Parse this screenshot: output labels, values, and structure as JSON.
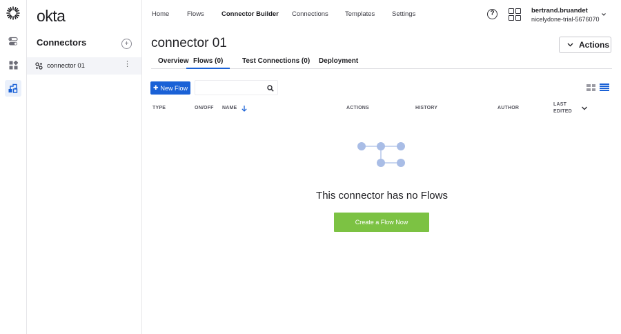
{
  "brand": "okta",
  "top_nav": {
    "items": [
      {
        "label": "Home",
        "active": false
      },
      {
        "label": "Flows",
        "active": false
      },
      {
        "label": "Connector Builder",
        "active": true
      },
      {
        "label": "Connections",
        "active": false
      },
      {
        "label": "Templates",
        "active": false
      },
      {
        "label": "Settings",
        "active": false
      }
    ],
    "help_glyph": "?",
    "user": {
      "name": "bertrand.bruandet",
      "org": "nicelydone-trial-5676070"
    }
  },
  "connectors_panel": {
    "title": "Connectors",
    "add_glyph": "+",
    "items": [
      {
        "label": "connector 01",
        "more_glyph": "⋮"
      }
    ]
  },
  "main": {
    "title": "connector 01",
    "actions_label": "Actions",
    "tabs": [
      {
        "label": "Overview",
        "active": false
      },
      {
        "label": "Flows (0)",
        "active": true
      },
      {
        "label": "Test Connections (0)",
        "active": false
      },
      {
        "label": "Deployment",
        "active": false
      }
    ],
    "new_flow_label": "New Flow",
    "new_flow_glyph": "✚",
    "search": {
      "value": "",
      "placeholder": ""
    },
    "columns": {
      "type": "TYPE",
      "on_off": "ON/OFF",
      "name": "NAME",
      "actions": "ACTIONS",
      "history": "HISTORY",
      "author": "AUTHOR",
      "last_edited_1": "LAST",
      "last_edited_2": "EDITED"
    },
    "empty_message": "This connector has no Flows",
    "create_button": "Create a Flow Now"
  },
  "colors": {
    "accent": "#1a61d6",
    "success": "#7cc243",
    "illustration": "#a9bde6"
  }
}
